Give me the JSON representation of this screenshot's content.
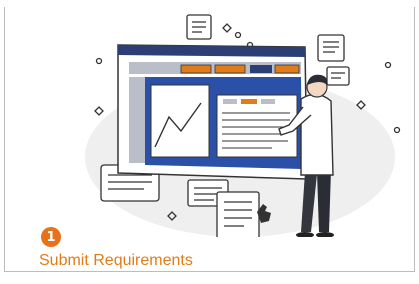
{
  "step": {
    "number": "1",
    "title": "Submit Requirements"
  },
  "colors": {
    "accent": "#e8711c",
    "title": "#e07c1a",
    "board_frame": "#2c3e73",
    "board_panel": "#2b50a8",
    "floating_blob": "#efefef"
  },
  "illustration": {
    "icons": [
      "presentation-board-icon",
      "line-chart-icon",
      "text-document-icon",
      "businessman-icon",
      "cursor-hand-icon"
    ]
  }
}
